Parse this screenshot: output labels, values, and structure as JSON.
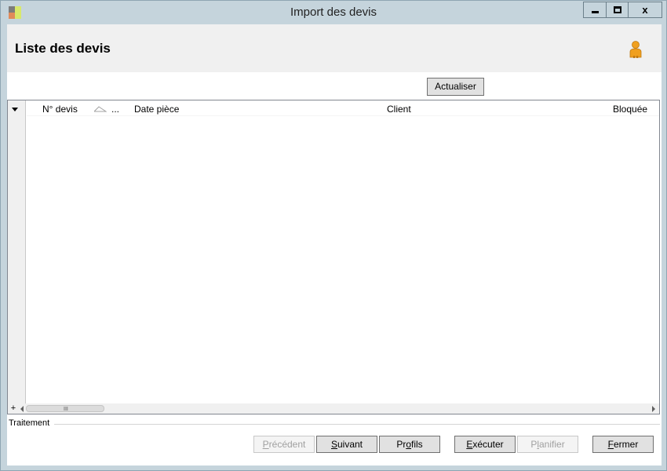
{
  "window": {
    "title": "Import des devis",
    "controls": {
      "minimize_icon": "minimize-icon",
      "maximize_icon": "maximize-icon",
      "close_label": "x"
    }
  },
  "header": {
    "title": "Liste des devis",
    "user_icon": "user-icon"
  },
  "toolbar": {
    "refresh_label": "Actualiser"
  },
  "grid": {
    "columns": [
      {
        "label": "N° devis"
      },
      {
        "label": "..."
      },
      {
        "label": "Date pièce"
      },
      {
        "label": "Client"
      },
      {
        "label": "Bloquée"
      }
    ],
    "rows": [],
    "add_label": "+",
    "scroll_grip": "III"
  },
  "section": {
    "label": "Traitement"
  },
  "buttons": {
    "previous": {
      "first": "P",
      "rest": "récédent",
      "enabled": false
    },
    "next": {
      "first": "S",
      "rest": "uivant",
      "enabled": true
    },
    "profiles": {
      "pre": "Pr",
      "under": "o",
      "rest": "fils",
      "enabled": true
    },
    "execute": {
      "first": "E",
      "rest": "xécuter",
      "enabled": true
    },
    "schedule": {
      "pre": "P",
      "under": "l",
      "rest": "anifier",
      "enabled": false
    },
    "close": {
      "first": "F",
      "rest": "ermer",
      "enabled": true
    }
  },
  "colors": {
    "window_frame": "#c5d4dc",
    "header_band": "#f0f0f0",
    "button_face": "#e1e1e1",
    "user_icon": "#f0a020"
  }
}
